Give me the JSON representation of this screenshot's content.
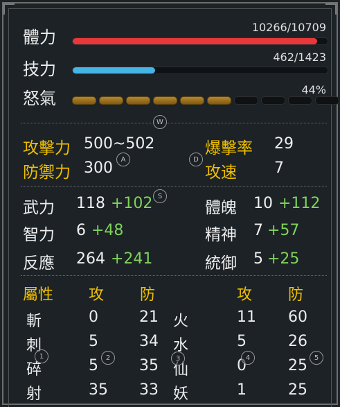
{
  "bars": {
    "hp": {
      "label": "體力",
      "value": "10266/10709",
      "fraction": 0.9586,
      "color": "#e8383a"
    },
    "sp": {
      "label": "技力",
      "value": "462/1423",
      "fraction": 0.3247,
      "color": "#43b6e6"
    },
    "rage": {
      "label": "怒氣",
      "value": "44%",
      "segments_total": 10,
      "segments_filled": 6
    }
  },
  "badges": {
    "w": "W",
    "a": "A",
    "d": "D",
    "s": "S",
    "n1": "1",
    "n2": "2",
    "n3": "3",
    "n4": "4",
    "n5": "5"
  },
  "combat": {
    "attack_label": "攻擊力",
    "attack_value": "500~502",
    "crit_label": "爆擊率",
    "crit_value": "29",
    "defense_label": "防禦力",
    "defense_value": "300",
    "speed_label": "攻速",
    "speed_value": "7"
  },
  "stats": {
    "wuli": {
      "label": "武力",
      "value": "118",
      "bonus": "+102"
    },
    "tipo": {
      "label": "體魄",
      "value": "10",
      "bonus": "+112"
    },
    "zhili": {
      "label": "智力",
      "value": "6",
      "bonus": "+48"
    },
    "jingshen": {
      "label": "精神",
      "value": "7",
      "bonus": "+57"
    },
    "fanying": {
      "label": "反應",
      "value": "264",
      "bonus": "+241"
    },
    "tongyu": {
      "label": "統御",
      "value": "5",
      "bonus": "+25"
    }
  },
  "attributes": {
    "header": {
      "title": "屬性",
      "atk": "攻",
      "def": "防",
      "atk2": "攻",
      "def2": "防"
    },
    "rows": [
      {
        "name": "斬",
        "atk": "0",
        "def": "21",
        "name2": "火",
        "atk2": "11",
        "def2": "60"
      },
      {
        "name": "刺",
        "atk": "5",
        "def": "34",
        "name2": "水",
        "atk2": "5",
        "def2": "26"
      },
      {
        "name": "碎",
        "atk": "5",
        "def": "35",
        "name2": "仙",
        "atk2": "0",
        "def2": "25"
      },
      {
        "name": "射",
        "atk": "35",
        "def": "33",
        "name2": "妖",
        "atk2": "1",
        "def2": "25"
      }
    ]
  }
}
